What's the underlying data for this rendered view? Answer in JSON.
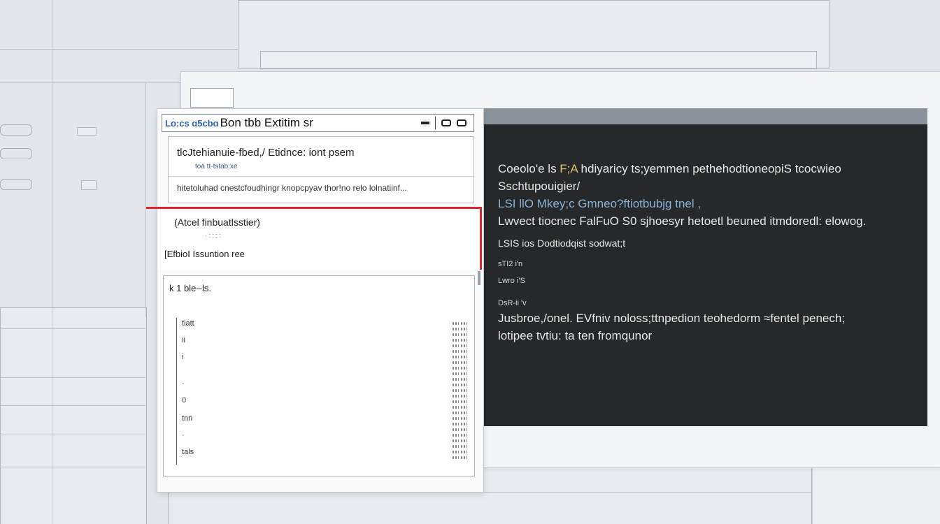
{
  "dialog": {
    "title_prefix": "Lo:cs ɑ5cbɑ",
    "title": "Bon  tbb  Extitim  sr",
    "section_a": {
      "row1": "tlcJtehianuie-fbed,/ Etidnce: iont  psem",
      "row1_sub": "toa tt·tstab:xe",
      "row2": "hitetoluhad cnestcfoudhingr knopcpyav thor!no relo lolnatiinf..."
    },
    "section_b": {
      "label1": "(Atcel finbuatlsstier)",
      "sub": "· : : :  :",
      "label2": "[EfbioI  Issuntion  ree"
    },
    "section_c": {
      "head": "k  1 ble--ls.",
      "items": [
        "tiatt",
        "ii",
        "i",
        "·",
        "0",
        "tnn",
        "·",
        "tals"
      ]
    }
  },
  "terminal": {
    "lines": [
      {
        "pre": "Coeolo'e ls ",
        "accent": "F;A",
        "post": " hdiyaricy ts;yemmen  pethehodtioneopiS tcocwieo"
      },
      {
        "pre": "Sschtupouigier/",
        "accent": "",
        "post": ""
      },
      {
        "pre": "LSI  llO Mkey;c  Gmneo?ftiotbubjg  tnel  ,",
        "accent": "",
        "post": ""
      },
      {
        "pre": "Lwvect tiocnec  FalFuO S0 sjhoesyr  hetoetl beuned  itmdoredl:  elowog.",
        "accent": "",
        "post": ""
      },
      {
        "pre": "LSIS  ios    Dodtiodqist sodwat;t",
        "accent": "",
        "post": ""
      },
      {
        "pre": "sTI2  i'n",
        "accent": "",
        "post": ""
      },
      {
        "pre": "Lwro  i'S",
        "accent": "",
        "post": ""
      },
      {
        "pre": "DsR-ii 'v",
        "accent": "",
        "post": ""
      },
      {
        "pre": "Jusbroe,/onel. EVfniv  noloss;ttnpedion  teohedorm  ≈fentel  penech;",
        "accent": "",
        "post": ""
      },
      {
        "pre": "lotipee tvtiu: ta ten  fromqunor",
        "accent": "",
        "post": ""
      }
    ]
  },
  "colors": {
    "terminal_bg": "#262829",
    "accent_yellow": "#e0c56c",
    "highlight_red": "#d9262b",
    "title_blue": "#2b63b7"
  }
}
